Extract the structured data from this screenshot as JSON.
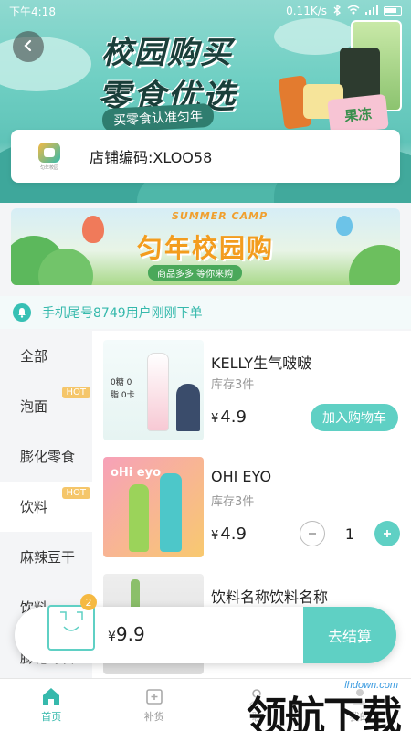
{
  "status_bar": {
    "time": "下午4:18",
    "speed": "0.11K/s"
  },
  "hero": {
    "title_line1": "校园购买",
    "title_line2": "零食优选",
    "tagline": "买零食认准匀年",
    "snack_label": "果冻"
  },
  "store": {
    "logo_caption": "匀年校园",
    "code": "店铺编码:XLOO58"
  },
  "promo": {
    "headline": "匀年校园购",
    "english": "SUMMER CAMP",
    "sub": "商品多多  等你来购"
  },
  "notice": {
    "text": "手机尾号8749用户刚刚下单"
  },
  "categories": [
    {
      "label": "全部",
      "hot": ""
    },
    {
      "label": "泡面",
      "hot": "HOT"
    },
    {
      "label": "膨化零食",
      "hot": ""
    },
    {
      "label": "饮料",
      "hot": "HOT"
    },
    {
      "label": "麻辣豆干",
      "hot": ""
    },
    {
      "label": "饮料",
      "hot": ""
    },
    {
      "label": "膨化零食",
      "hot": ""
    }
  ],
  "products": [
    {
      "name": "KELLY生气啵啵",
      "stock": "库存3件",
      "currency": "¥",
      "price": "4.9",
      "action": "加入购物车",
      "image_text": "0糖 0脂 0卡"
    },
    {
      "name": "OHI EYO",
      "stock": "库存3件",
      "currency": "¥",
      "price": "4.9",
      "quantity": "1",
      "image_text": "oHi eyo"
    },
    {
      "name": "饮料名称饮料名称",
      "stock": "",
      "currency": "¥",
      "price": ""
    }
  ],
  "cart": {
    "badge": "2",
    "currency": "¥",
    "total": "9.9",
    "checkout_label": "去结算"
  },
  "nav": [
    {
      "label": "首页",
      "icon": "home-icon",
      "active": true
    },
    {
      "label": "补货",
      "icon": "restock-icon",
      "active": false
    },
    {
      "label": "联",
      "icon": "contact-icon",
      "active": false
    },
    {
      "label": "我的",
      "icon": "profile-icon",
      "active": false
    }
  ],
  "watermark": {
    "big": "领航下载",
    "url": "lhdown.com"
  },
  "colors": {
    "accent": "#5fd0c4",
    "accent_dark": "#36b9ac",
    "hot_badge": "#f5c66a"
  }
}
